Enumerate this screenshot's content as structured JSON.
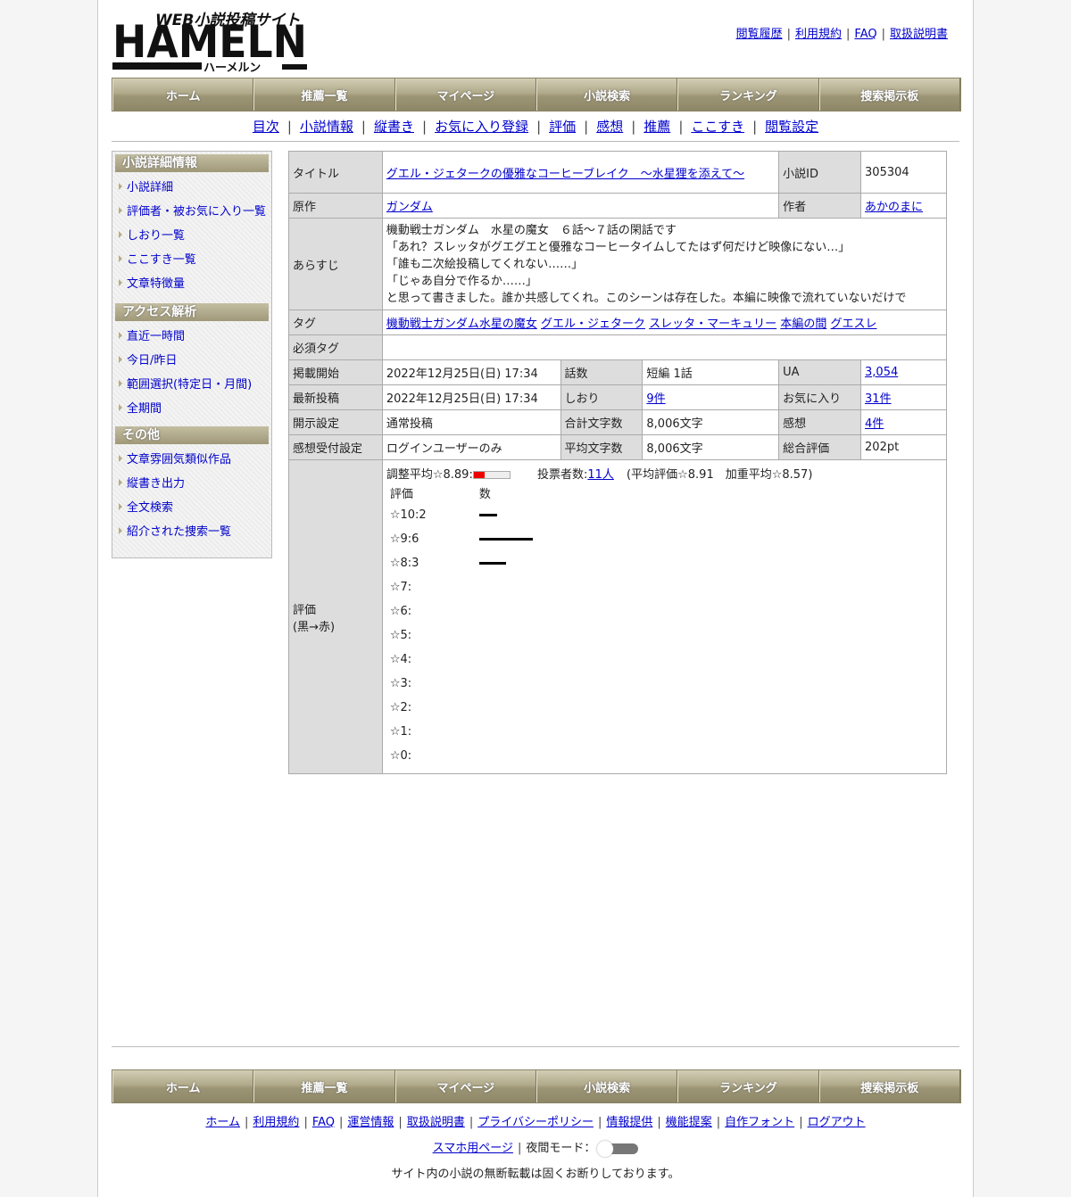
{
  "brand": {
    "tagline": "WEB小説投稿サイト",
    "logo_text": "HAMELN",
    "logo_kana": "ハーメルン"
  },
  "top_links": [
    "閲覧履歴",
    "利用規約",
    "FAQ",
    "取扱説明書"
  ],
  "nav": [
    "ホーム",
    "推薦一覧",
    "マイページ",
    "小説検索",
    "ランキング",
    "捜索掲示板"
  ],
  "subnav": [
    "目次",
    "小説情報",
    "縦書き",
    "お気に入り登録",
    "評価",
    "感想",
    "推薦",
    "ここすき",
    "閲覧設定"
  ],
  "sidebar": {
    "sections": [
      {
        "title": "小説詳細情報",
        "items": [
          "小説詳細",
          "評価者・被お気に入り一覧",
          "しおり一覧",
          "ここすき一覧",
          "文章特徴量"
        ]
      },
      {
        "title": "アクセス解析",
        "items": [
          "直近一時間",
          "今日/昨日",
          "範囲選択(特定日・月間)",
          "全期間"
        ]
      },
      {
        "title": "その他",
        "items": [
          "文章雰囲気類似作品",
          "縦書き出力",
          "全文検索",
          "紹介された捜索一覧"
        ]
      }
    ]
  },
  "info": {
    "title_label": "タイトル",
    "title": "グエル・ジェタークの優雅なコーヒーブレイク　〜水星狸を添えて〜",
    "id_label": "小説ID",
    "id": "305304",
    "original_label": "原作",
    "original": "ガンダム",
    "author_label": "作者",
    "author": "あかのまに",
    "synopsis_label": "あらすじ",
    "synopsis": [
      "機動戦士ガンダム　水星の魔女　６話〜７話の閑話です",
      "「あれ？スレッタがグエグエと優雅なコーヒータイムしてたはず何だけど映像にない…」",
      "「誰も二次絵投稿してくれない……」",
      "「じゃあ自分で作るか……」",
      "と思って書きました。誰か共感してくれ。このシーンは存在した。本編に映像で流れていないだけで"
    ],
    "tags_label": "タグ",
    "tags": [
      "機動戦士ガンダム水星の魔女",
      "グエル・ジェターク",
      "スレッタ・マーキュリー",
      "本編の間",
      "グエスレ"
    ],
    "required_tags_label": "必須タグ",
    "rows": [
      {
        "l1": "掲載開始",
        "v1": "2022年12月25日(日) 17:34",
        "l2": "話数",
        "v2": "短編 1話",
        "l3": "UA",
        "v3": "3,054",
        "v3_link": true,
        "v2_link": false
      },
      {
        "l1": "最新投稿",
        "v1": "2022年12月25日(日) 17:34",
        "l2": "しおり",
        "v2": "9件",
        "l3": "お気に入り",
        "v3": "31件",
        "v3_link": true,
        "v2_link": true
      },
      {
        "l1": "開示設定",
        "v1": "通常投稿",
        "l2": "合計文字数",
        "v2": "8,006文字",
        "l3": "感想",
        "v3": "4件",
        "v3_link": true,
        "v2_link": false
      },
      {
        "l1": "感想受付設定",
        "v1": "ログインユーザーのみ",
        "l2": "平均文字数",
        "v2": "8,006文字",
        "l3": "総合評価",
        "v3": "202pt",
        "v3_link": false,
        "v2_link": false
      }
    ],
    "rating_label_1": "評価",
    "rating_label_2": "(黒→赤)",
    "adjusted_avg": "調整平均☆8.89:",
    "adjusted_avg_fraction": 0.3,
    "voters_prefix": "投票者数:",
    "voters": "11人",
    "avg_text": "(平均評価☆8.91　加重平均☆8.57)",
    "dist_header_rating": "評価",
    "dist_header_count": "数",
    "distribution": [
      {
        "label": "☆10:2",
        "count": 2
      },
      {
        "label": "☆9:6",
        "count": 6
      },
      {
        "label": "☆8:3",
        "count": 3
      },
      {
        "label": "☆7:",
        "count": 0
      },
      {
        "label": "☆6:",
        "count": 0
      },
      {
        "label": "☆5:",
        "count": 0
      },
      {
        "label": "☆4:",
        "count": 0
      },
      {
        "label": "☆3:",
        "count": 0
      },
      {
        "label": "☆2:",
        "count": 0
      },
      {
        "label": "☆1:",
        "count": 0
      },
      {
        "label": "☆0:",
        "count": 0
      }
    ]
  },
  "footer_links": [
    "ホーム",
    "利用規約",
    "FAQ",
    "運営情報",
    "取扱説明書",
    "プライバシーポリシー",
    "情報提供",
    "機能提案",
    "自作フォント",
    "ログアウト"
  ],
  "footer_mobile": "スマホ用ページ",
  "night_mode_label": "夜間モード：",
  "notice": "サイト内の小説の無断転載は固くお断りしております。"
}
